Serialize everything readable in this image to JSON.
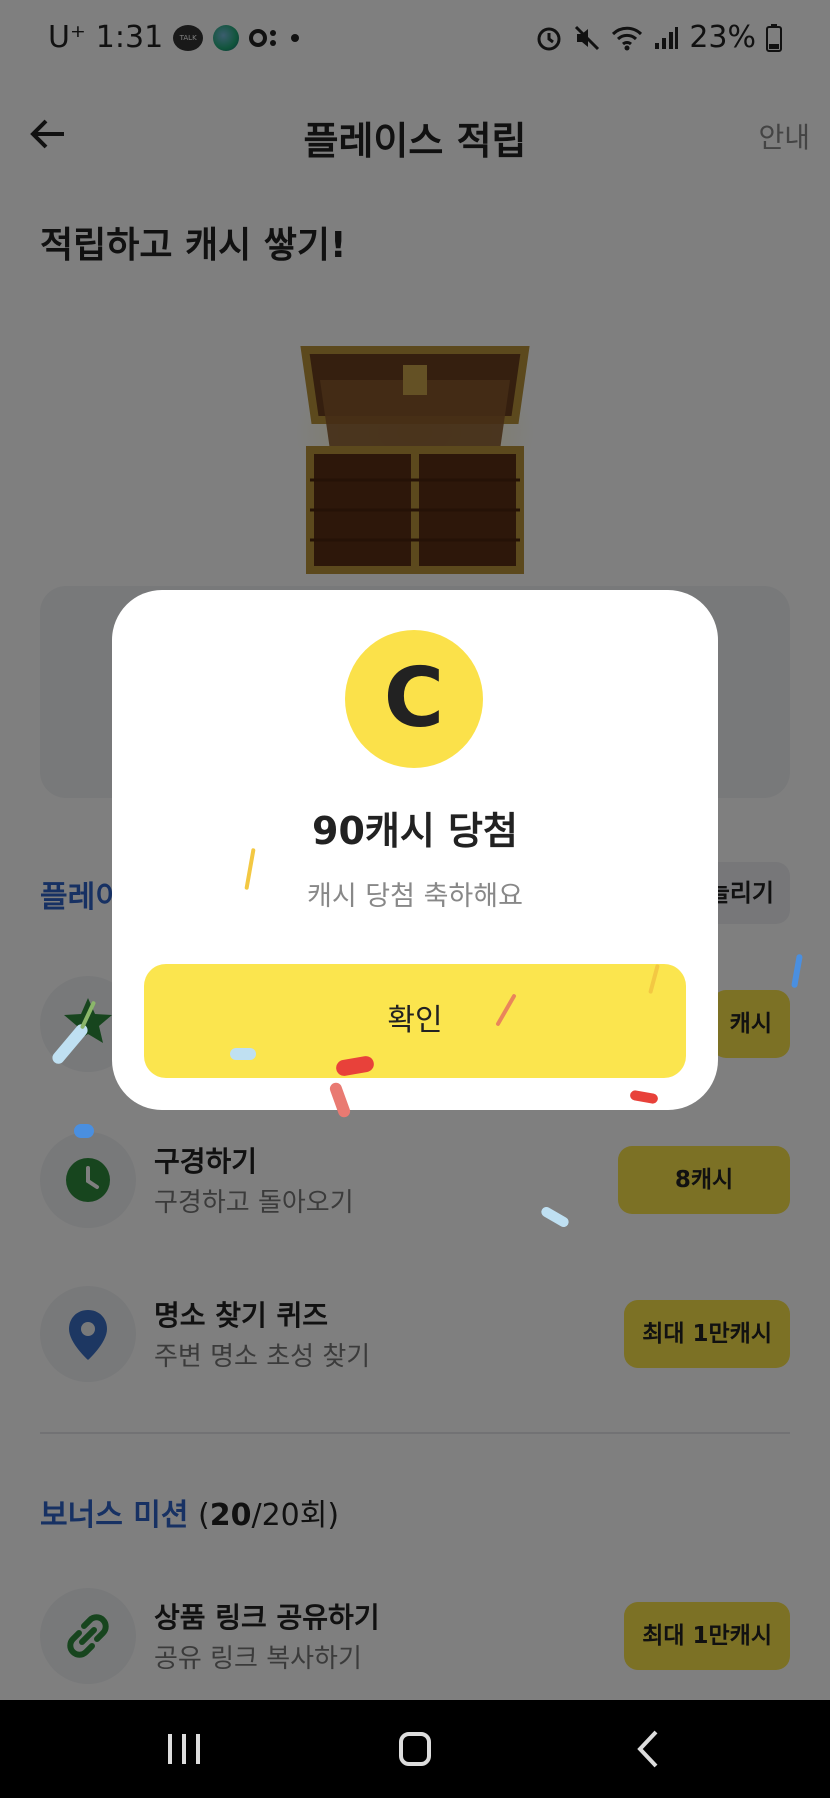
{
  "status_bar": {
    "carrier": "U⁺",
    "time": "1:31",
    "talk_icon_text": "TALK",
    "battery": "23%"
  },
  "header": {
    "title": "플레이스 적립",
    "guide_label": "안내"
  },
  "headline": "적립하고 캐시 쌓기!",
  "section": {
    "title_visible": "플레이",
    "more_visible": "늘리기"
  },
  "missions": [
    {
      "icon": "star-icon",
      "name": "",
      "desc": "",
      "reward": "캐시"
    },
    {
      "icon": "clock-icon",
      "name": "구경하기",
      "desc": "구경하고 돌아오기",
      "reward": "8캐시"
    },
    {
      "icon": "location-pin-icon",
      "name": "명소 찾기 퀴즈",
      "desc": "주변 명소 초성 찾기",
      "reward": "최대 1만캐시"
    }
  ],
  "bonus": {
    "title": "보너스 미션",
    "count_bold": "20",
    "count_rest": "/20회)",
    "count_open": "("
  },
  "bonus_missions": [
    {
      "icon": "link-icon",
      "name": "상품 링크 공유하기",
      "desc": "공유 링크 복사하기",
      "reward": "최대 1만캐시"
    }
  ],
  "modal": {
    "coin_letter": "C",
    "title": "90캐시 당첨",
    "subtitle": "캐시 당첨 축하해요",
    "confirm_label": "확인"
  },
  "colors": {
    "accent_yellow": "#fbe14a",
    "section_blue": "#2f62c6",
    "icon_green": "#2e8b3d",
    "icon_blue": "#3a6fc4"
  }
}
